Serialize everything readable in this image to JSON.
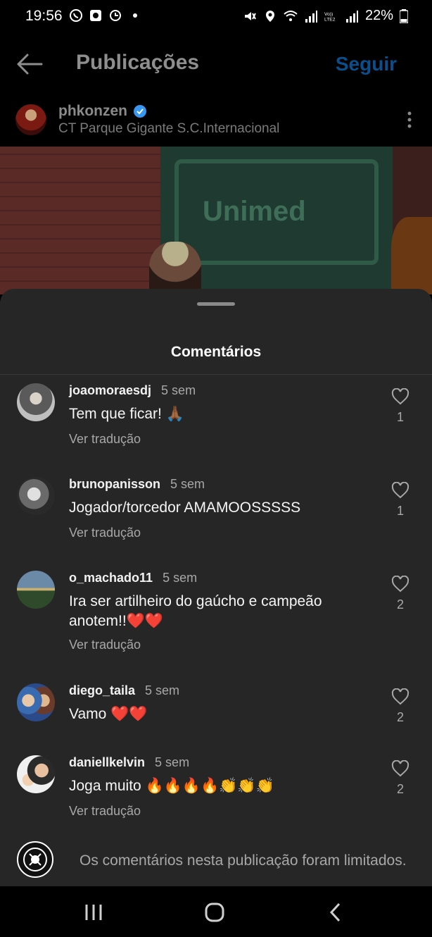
{
  "status_bar": {
    "time": "19:56",
    "battery": "22%"
  },
  "header": {
    "title": "Publicações",
    "follow_label": "Seguir"
  },
  "post": {
    "username": "phkonzen",
    "location": "CT Parque Gigante S.C.Internacional",
    "image_sign_text": "Unimed"
  },
  "comments_sheet": {
    "title": "Comentários",
    "comments": [
      {
        "username": "joaomoraesdj",
        "time": "5 sem",
        "text": "Tem que ficar! 🙏🏾",
        "translate": "Ver tradução",
        "likes": "1"
      },
      {
        "username": "brunopanisson",
        "time": "5 sem",
        "text": "Jogador/torcedor AMAMOOSSSSS",
        "translate": "Ver tradução",
        "likes": "1"
      },
      {
        "username": "o_machado11",
        "time": "5 sem",
        "text": "Ira ser artilheiro do gaúcho e campeão anotem!!❤️❤️",
        "translate": "Ver tradução",
        "likes": "2"
      },
      {
        "username": "diego_taila",
        "time": "5 sem",
        "text": "Vamo ❤️❤️",
        "translate": "",
        "likes": "2"
      },
      {
        "username": "daniellkelvin",
        "time": "5 sem",
        "text": "Joga muito 🔥🔥🔥🔥👏👏👏",
        "translate": "Ver tradução",
        "likes": "2"
      }
    ],
    "limited_notice": "Os comentários nesta publicação foram limitados."
  },
  "colors": {
    "sheet_bg": "#262626",
    "follow_blue": "#0a4f8c",
    "verified_blue": "#3897f0"
  }
}
